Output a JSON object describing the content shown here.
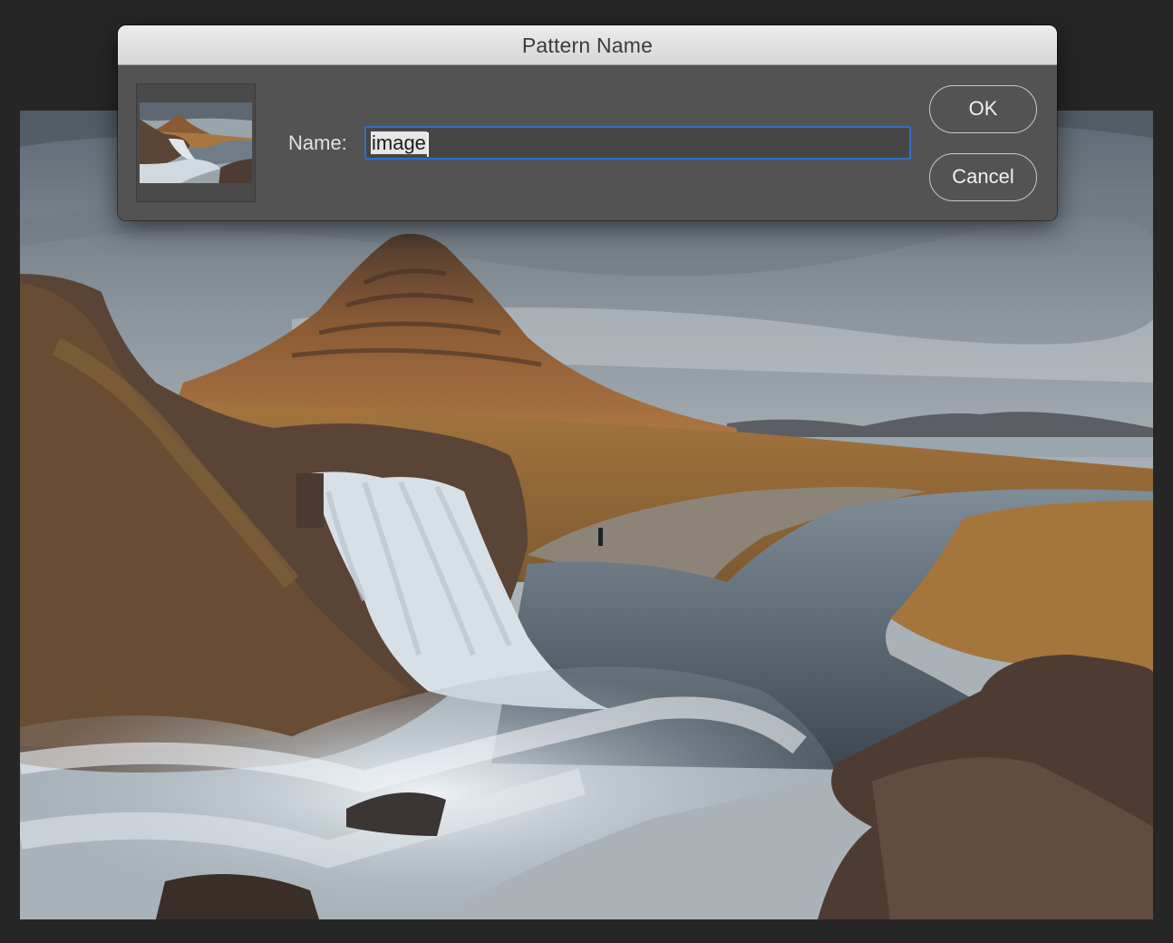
{
  "dialog": {
    "title": "Pattern Name",
    "name_label": "Name:",
    "name_value": "image",
    "ok_label": "OK",
    "cancel_label": "Cancel"
  },
  "canvas": {
    "image_subject": "landscape-photo-waterfall-mountain"
  },
  "colors": {
    "dialog_bg": "#535353",
    "titlebar_bg": "#e3e3e3",
    "focus_ring": "#2f6fc4",
    "app_bg": "#262626"
  }
}
